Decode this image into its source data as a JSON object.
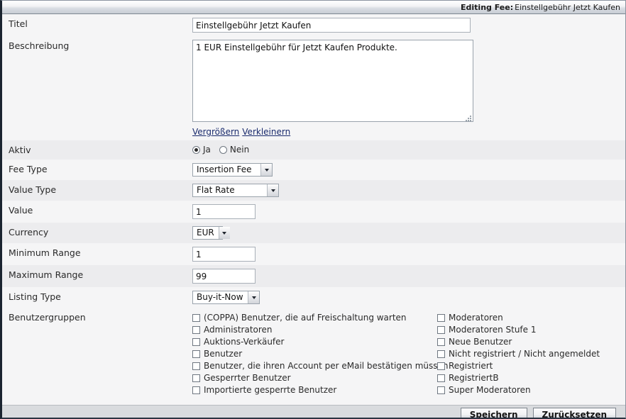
{
  "titlebar": {
    "prefix": "Editing Fee:",
    "value": "Einstellgebühr Jetzt Kaufen"
  },
  "fields": {
    "titel": {
      "label": "Titel",
      "value": "Einstellgebühr Jetzt Kaufen",
      "placeholder": ""
    },
    "beschreibung": {
      "label": "Beschreibung",
      "value": "1 EUR Einstellgebühr für Jetzt Kaufen Produkte.",
      "placeholder": "",
      "link_enlarge": "Vergrößern",
      "link_shrink": "Verkleinern"
    },
    "aktiv": {
      "label": "Aktiv",
      "options": [
        "Ja",
        "Nein"
      ],
      "selected": "Ja"
    },
    "fee_type": {
      "label": "Fee Type",
      "value": "Insertion Fee"
    },
    "value_type": {
      "label": "Value Type",
      "value": "Flat Rate"
    },
    "value": {
      "label": "Value",
      "value": "1",
      "placeholder": ""
    },
    "currency": {
      "label": "Currency",
      "value": "EUR"
    },
    "minimum_range": {
      "label": "Minimum Range",
      "value": "1",
      "placeholder": ""
    },
    "maximum_range": {
      "label": "Maximum Range",
      "value": "99",
      "placeholder": ""
    },
    "listing_type": {
      "label": "Listing Type",
      "value": "Buy-it-Now"
    },
    "benutzergruppen": {
      "label": "Benutzergruppen",
      "left_column": [
        {
          "label": "(COPPA) Benutzer, die auf Freischaltung warten",
          "checked": false
        },
        {
          "label": "Administratoren",
          "checked": false
        },
        {
          "label": "Auktions-Verkäufer",
          "checked": false
        },
        {
          "label": "Benutzer",
          "checked": false
        },
        {
          "label": "Benutzer, die ihren Account per eMail bestätigen müssen",
          "checked": false
        },
        {
          "label": "Gesperrter Benutzer",
          "checked": false
        },
        {
          "label": "Importierte gesperrte Benutzer",
          "checked": false
        }
      ],
      "right_column": [
        {
          "label": "Moderatoren",
          "checked": false
        },
        {
          "label": "Moderatoren Stufe 1",
          "checked": false
        },
        {
          "label": "Neue Benutzer",
          "checked": false
        },
        {
          "label": "Nicht registriert / Nicht angemeldet",
          "checked": false
        },
        {
          "label": "Registriert",
          "checked": false
        },
        {
          "label": "RegistriertB",
          "checked": false
        },
        {
          "label": "Super Moderatoren",
          "checked": false
        }
      ]
    }
  },
  "footer": {
    "save_label": "Speichern",
    "reset_label": "Zurücksetzen"
  },
  "colors": {
    "row_light": "#f5f5f6",
    "row_dark": "#ececee",
    "footer_bg": "#d9dbde",
    "link": "#1a2b6d",
    "frame_border": "#1b2430"
  }
}
